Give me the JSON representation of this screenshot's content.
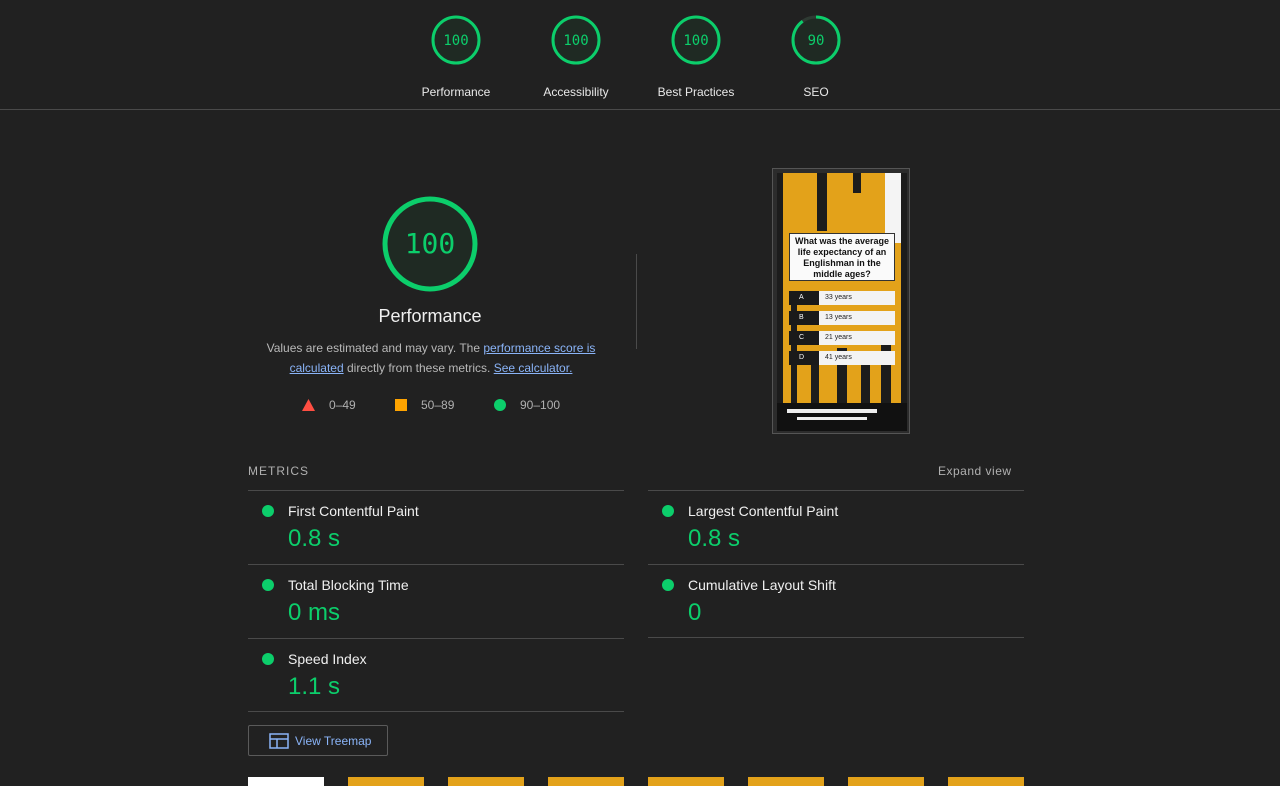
{
  "summary": [
    {
      "score": "100",
      "label": "Performance"
    },
    {
      "score": "100",
      "label": "Accessibility"
    },
    {
      "score": "100",
      "label": "Best Practices"
    },
    {
      "score": "90",
      "label": "SEO"
    }
  ],
  "performance": {
    "score": "100",
    "title": "Performance",
    "desc_prefix": "Values are estimated and may vary. The ",
    "desc_link1": "performance score is calculated",
    "desc_middle": " directly from these metrics. ",
    "desc_link2": "See calculator."
  },
  "legend": {
    "fail": "0–49",
    "average": "50–89",
    "pass": "90–100"
  },
  "screenshot": {
    "question": "What was the average life expectancy of an Englishman in the middle ages?",
    "answers": [
      {
        "letter": "A",
        "text": "33 years"
      },
      {
        "letter": "B",
        "text": "13 years"
      },
      {
        "letter": "C",
        "text": "21 years"
      },
      {
        "letter": "D",
        "text": "41 years"
      }
    ]
  },
  "metrics": {
    "heading": "METRICS",
    "expand": "Expand view",
    "fcp": {
      "name": "First Contentful Paint",
      "value": "0.8 s"
    },
    "lcp": {
      "name": "Largest Contentful Paint",
      "value": "0.8 s"
    },
    "tbt": {
      "name": "Total Blocking Time",
      "value": "0 ms"
    },
    "cls": {
      "name": "Cumulative Layout Shift",
      "value": "0"
    },
    "si": {
      "name": "Speed Index",
      "value": "1.1 s"
    }
  },
  "treemap": {
    "label": "View Treemap"
  },
  "colors": {
    "pass": "#0cce6b",
    "average": "#ffa400",
    "fail": "#ff4e42",
    "link": "#8ab4f8",
    "background": "#212121"
  },
  "gauge_fill": {
    "performance": 1.0,
    "accessibility": 1.0,
    "best_practices": 1.0,
    "seo": 0.9
  }
}
